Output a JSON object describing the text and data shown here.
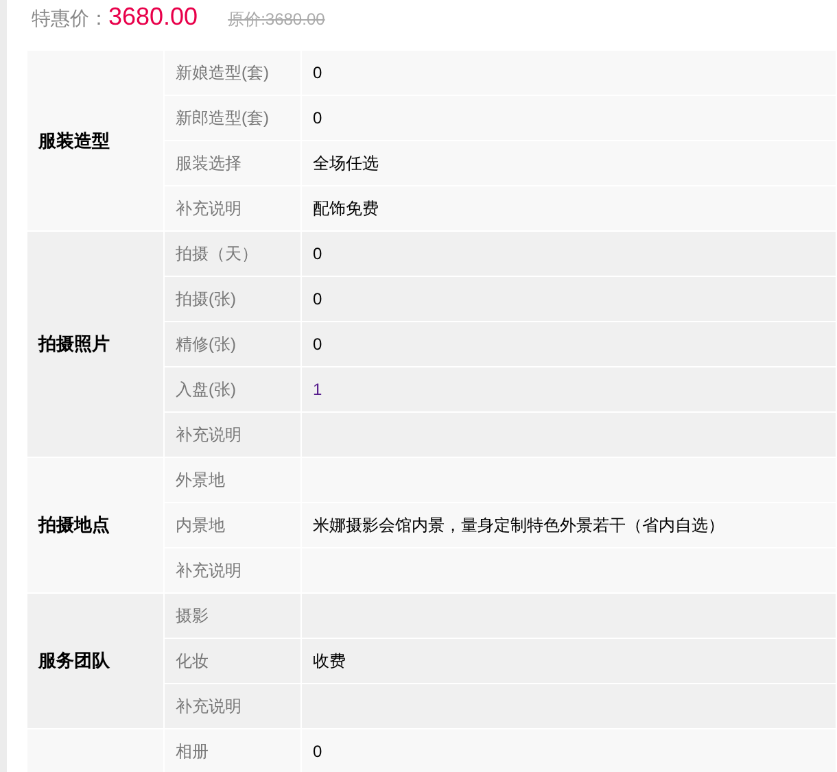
{
  "price": {
    "label": "特惠价：",
    "value": "3680.00",
    "original": "原价:3680.00"
  },
  "groups": [
    {
      "name": "服装造型",
      "rows": [
        {
          "label": "新娘造型(套)",
          "value": "0"
        },
        {
          "label": "新郎造型(套)",
          "value": "0"
        },
        {
          "label": "服装选择",
          "value": "全场任选"
        },
        {
          "label": "补充说明",
          "value": "配饰免费"
        }
      ]
    },
    {
      "name": "拍摄照片",
      "rows": [
        {
          "label": "拍摄（天）",
          "value": "0"
        },
        {
          "label": "拍摄(张)",
          "value": "0"
        },
        {
          "label": "精修(张)",
          "value": "0"
        },
        {
          "label": "入盘(张)",
          "value": "1",
          "link": true
        },
        {
          "label": "补充说明"
        }
      ]
    },
    {
      "name": "拍摄地点",
      "rows": [
        {
          "label": "外景地"
        },
        {
          "label": "内景地",
          "value": "米娜摄影会馆内景，量身定制特色外景若干（省内自选）"
        },
        {
          "label": "补充说明"
        }
      ]
    },
    {
      "name": "服务团队",
      "rows": [
        {
          "label": "摄影"
        },
        {
          "label": "化妆",
          "value": "收费"
        },
        {
          "label": "补充说明"
        }
      ]
    },
    {
      "rows": [
        {
          "label": "相册",
          "value": "0"
        }
      ]
    }
  ]
}
